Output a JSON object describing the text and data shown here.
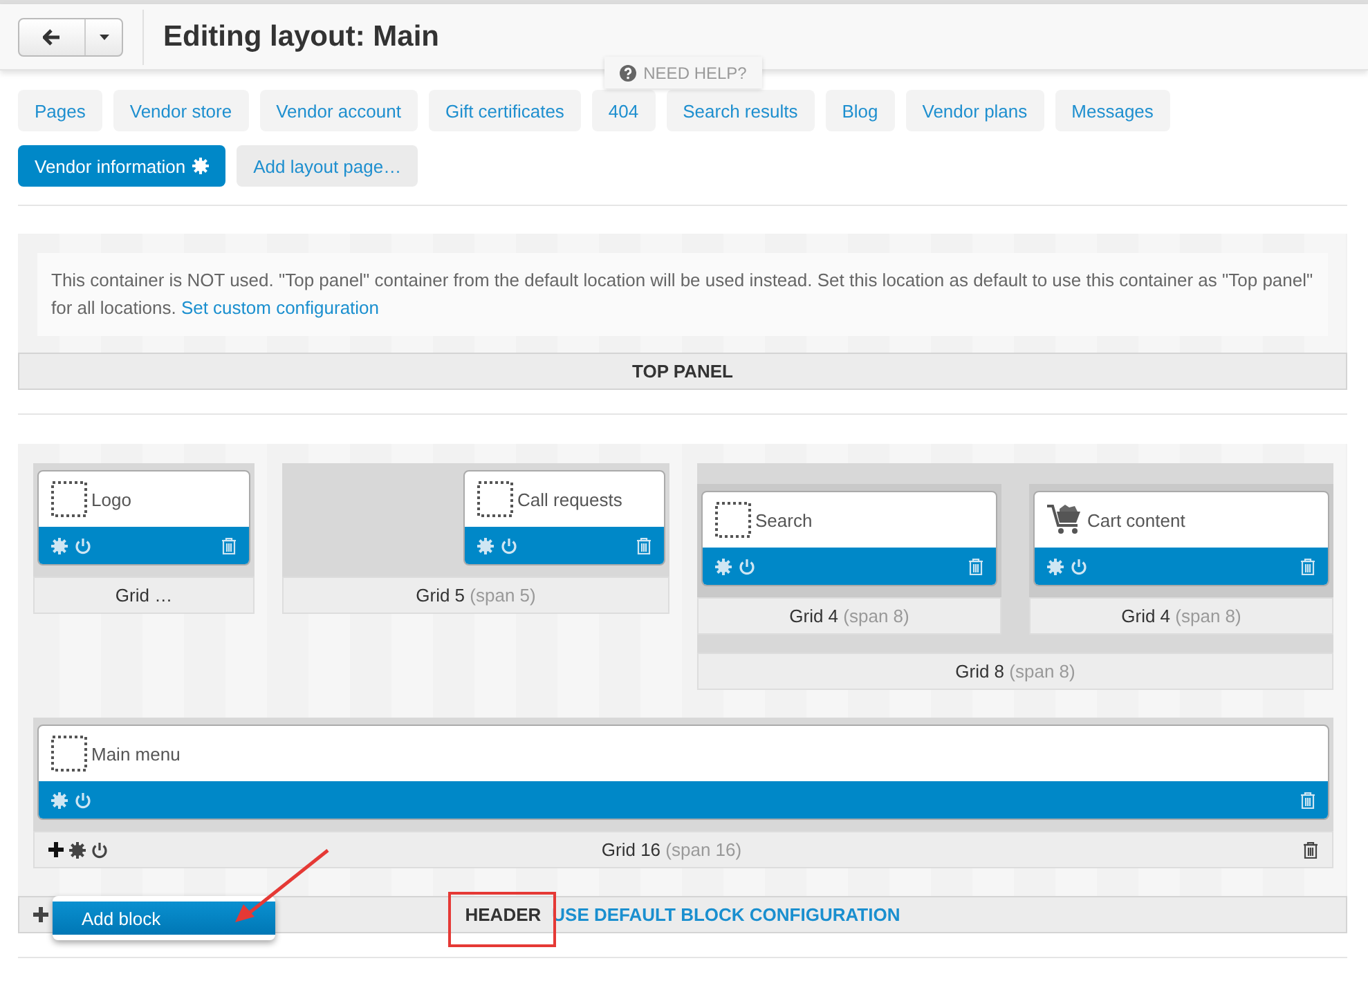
{
  "title": "Editing layout: Main",
  "help_label": "NEED HELP?",
  "layout_tabs": [
    {
      "label": "Pages",
      "kind": "page",
      "selected": false
    },
    {
      "label": "Vendor store",
      "kind": "page",
      "selected": false
    },
    {
      "label": "Vendor account",
      "kind": "page",
      "selected": false
    },
    {
      "label": "Gift certificates",
      "kind": "page",
      "selected": false
    },
    {
      "label": "404",
      "kind": "page",
      "selected": false
    },
    {
      "label": "Search results",
      "kind": "page",
      "selected": false
    },
    {
      "label": "Blog",
      "kind": "page",
      "selected": false
    },
    {
      "label": "Vendor plans",
      "kind": "page",
      "selected": false
    },
    {
      "label": "Messages",
      "kind": "page",
      "selected": false
    },
    {
      "label": "Vendor information",
      "kind": "page",
      "selected": true
    },
    {
      "label": "Add layout page…",
      "kind": "add",
      "selected": false
    }
  ],
  "containers": [
    {
      "kind": "notice",
      "notice": "This container is NOT used. \"Top panel\" container from the default location will be used instead. Set this location as default to use this container as \"Top panel\" for all locations.",
      "notice_link": "Set custom configuration",
      "footer": {
        "title": "TOP PANEL"
      }
    },
    {
      "kind": "grids",
      "rows": [
        [
          {
            "title": "Grid …",
            "tools": false,
            "blocks": [
              {
                "name": "Logo",
                "kind": "empty"
              }
            ]
          },
          {
            "title": "Grid 5",
            "span": "(span 5)",
            "tools": false,
            "blocks": [
              {
                "name": "Call requests",
                "kind": "empty"
              }
            ]
          },
          {
            "title": "Grid 8",
            "span": "(span 8)",
            "tools": false,
            "children": [
              {
                "title": "Grid 4",
                "span": "(span 8)",
                "tools": false,
                "blocks": [
                  {
                    "name": "Search",
                    "kind": "empty"
                  }
                ]
              },
              {
                "title": "Grid 4",
                "span": "(span 8)",
                "tools": false,
                "blocks": [
                  {
                    "name": "Cart content",
                    "kind": "cart"
                  }
                ]
              }
            ]
          }
        ],
        [
          {
            "title": "Grid 16",
            "span": "(span 16)",
            "tools": true,
            "blocks": [
              {
                "name": "Main menu",
                "kind": "empty"
              }
            ]
          }
        ]
      ],
      "footer": {
        "title": "HEADER",
        "link": "USE DEFAULT BLOCK CONFIGURATION",
        "menu": [
          {
            "label": "Add block",
            "selected": true
          }
        ]
      }
    }
  ]
}
